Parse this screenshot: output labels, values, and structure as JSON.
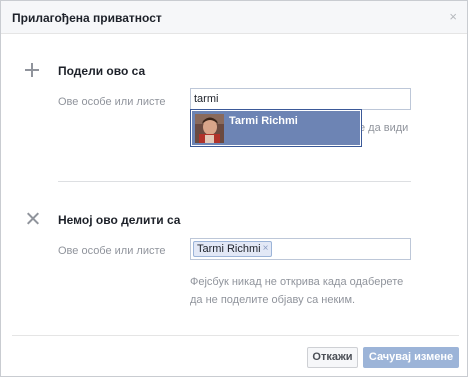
{
  "dialog": {
    "title": "Прилагођена приватност",
    "close_glyph": "×"
  },
  "share": {
    "title": "Подели ово са",
    "field_label": "Ове особе или листе",
    "input_value": "tarmi",
    "suggestion_name": "Tarmi Richmi",
    "obscured_text": "е да види"
  },
  "noshare": {
    "title": "Немој ово делити са",
    "field_label": "Ове особе или листе",
    "token_label": "Tarmi Richmi",
    "token_remove_glyph": "×",
    "note": "Фејсбук никад не открива када одаберете да не поделите објаву са неким."
  },
  "footer": {
    "cancel_label": "Откажи",
    "save_label": "Сачувај измене"
  },
  "icons": {
    "share_section": "plus-icon",
    "noshare_section": "x-icon",
    "close": "close-icon"
  },
  "colors": {
    "suggestion_highlight": "#6d84b4",
    "save_button_disabled": "#9cb4d8",
    "token_background": "#e2e8f6"
  }
}
